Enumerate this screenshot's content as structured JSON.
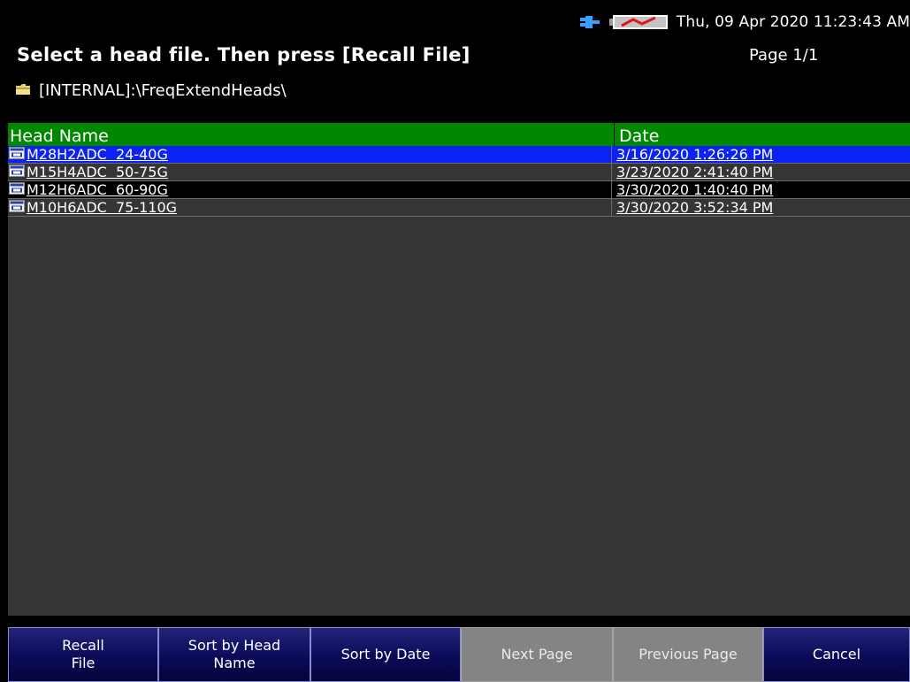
{
  "status": {
    "datetime": "Thu, 09 Apr 2020 11:23:43 AM"
  },
  "header": {
    "prompt": "Select a head file. Then press [Recall File]",
    "page_indicator": "Page 1/1",
    "path": "[INTERNAL]:\\FreqExtendHeads\\"
  },
  "table": {
    "columns": [
      "Head Name",
      "Date"
    ],
    "rows": [
      {
        "name": "M28H2ADC  24-40G",
        "date": "3/16/2020 1:26:26 PM"
      },
      {
        "name": "M15H4ADC  50-75G",
        "date": "3/23/2020 2:41:40 PM"
      },
      {
        "name": "M12H6ADC  60-90G",
        "date": "3/30/2020 1:40:40 PM"
      },
      {
        "name": "M10H6ADC  75-110G",
        "date": "3/30/2020 3:52:34 PM"
      }
    ]
  },
  "softkeys": [
    {
      "label": "Recall\nFile",
      "enabled": true
    },
    {
      "label": "Sort by Head\nName",
      "enabled": true
    },
    {
      "label": "Sort by Date",
      "enabled": true
    },
    {
      "label": "Next Page",
      "enabled": false
    },
    {
      "label": "Previous Page",
      "enabled": false
    },
    {
      "label": "Cancel",
      "enabled": true
    }
  ],
  "colors": {
    "selected_row": "#0b22f5",
    "header_green": "#008800",
    "softkey_blue": "#0b0b58",
    "softkey_disabled": "#848484"
  },
  "icons": [
    "network-plug-icon",
    "battery-charging-icon",
    "folder-icon",
    "file-icon"
  ]
}
